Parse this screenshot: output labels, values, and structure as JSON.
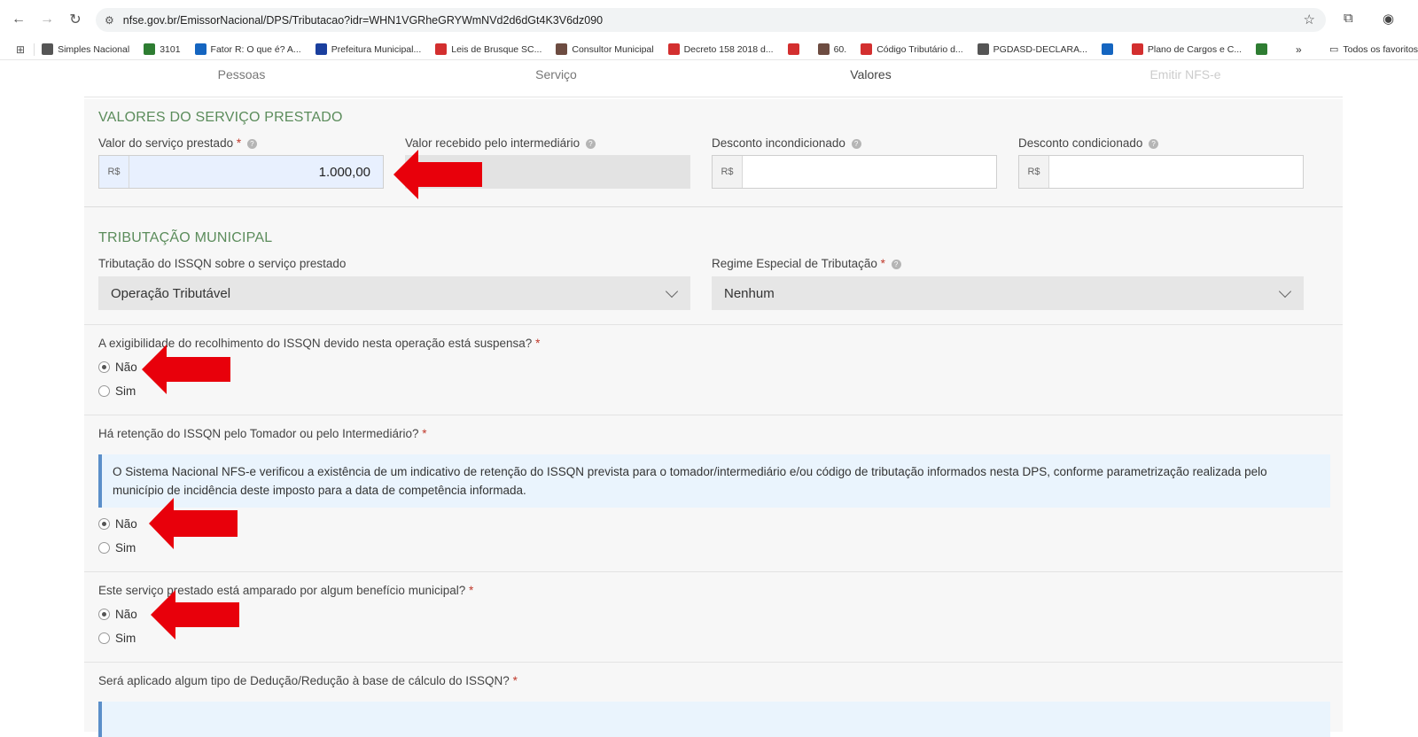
{
  "browser": {
    "url": "nfse.gov.br/EmissorNacional/DPS/Tributacao?idr=WHN1VGRheGRYWmNVd2d6dGt4K3V6dz090",
    "bookmarks": [
      {
        "label": "Simples Nacional",
        "color": "#555555"
      },
      {
        "label": "3101",
        "color": "#2e7d32"
      },
      {
        "label": "Fator R: O que é? A...",
        "color": "#1565c0"
      },
      {
        "label": "Prefeitura Municipal...",
        "color": "#1a3f9e"
      },
      {
        "label": "Leis de Brusque SC...",
        "color": "#d32f2f"
      },
      {
        "label": "Consultor Municipal",
        "color": "#6d4c41"
      },
      {
        "label": "Decreto 158 2018 d...",
        "color": "#d32f2f"
      },
      {
        "label": "",
        "color": "#d32f2f"
      },
      {
        "label": "60.",
        "color": "#6d4c41"
      },
      {
        "label": "Código Tributário d...",
        "color": "#d32f2f"
      },
      {
        "label": "PGDASD-DECLARA...",
        "color": "#555555"
      },
      {
        "label": "",
        "color": "#1565c0"
      },
      {
        "label": "Plano de Cargos e C...",
        "color": "#d32f2f"
      },
      {
        "label": "",
        "color": "#2e7d32"
      }
    ],
    "more": "»",
    "all_favorites": "Todos os favoritos"
  },
  "steps": [
    "Pessoas",
    "Serviço",
    "Valores",
    "Emitir NFS-e"
  ],
  "valores": {
    "title": "VALORES DO SERVIÇO PRESTADO",
    "valor_servico_label": "Valor do serviço prestado",
    "valor_servico": "1.000,00",
    "valor_intermediario_label": "Valor recebido pelo intermediário",
    "desconto_incond_label": "Desconto incondicionado",
    "desconto_cond_label": "Desconto condicionado",
    "currency": "R$",
    "required_mark": "*",
    "help": "?"
  },
  "tributacao": {
    "title": "TRIBUTAÇÃO MUNICIPAL",
    "issqn_label": "Tributação do ISSQN sobre o serviço prestado",
    "issqn_value": "Operação Tributável",
    "regime_label": "Regime Especial de Tributação",
    "regime_value": "Nenhum",
    "q1": "A exigibilidade do recolhimento do ISSQN devido nesta operação está suspensa?",
    "q2": "Há retenção do ISSQN pelo Tomador ou pelo Intermediário?",
    "info": "O Sistema Nacional NFS-e verificou a existência de um indicativo de retenção do ISSQN prevista para o tomador/intermediário e/ou código de tributação informados nesta DPS, conforme parametrização realizada pelo município de incidência deste imposto para a data de competência informada.",
    "q3": "Este serviço prestado está amparado por algum benefício municipal?",
    "q4": "Será aplicado algum tipo de Dedução/Redução à base de cálculo do ISSQN?",
    "opt_no": "Não",
    "opt_yes": "Sim"
  },
  "colors": {
    "arrow": "#e8000b",
    "section": "#5b8c5b",
    "info_border": "#5b8fc9"
  }
}
